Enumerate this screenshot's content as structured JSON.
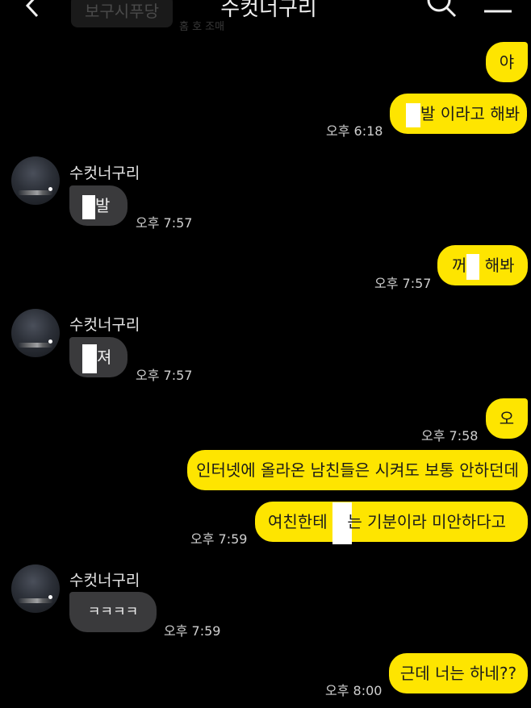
{
  "header": {
    "title": "수컷너구리",
    "chat_badge": "보구시푸당",
    "sub_caption": "홈 호 조매"
  },
  "colors": {
    "background": "#000000",
    "my_bubble": "#fee500",
    "their_bubble": "#3a3a3c"
  },
  "icons": {
    "back": "chevron-left-icon",
    "search": "search-icon",
    "menu": "hamburger-menu-icon"
  },
  "messages": [
    {
      "from": "me",
      "text": "야"
    },
    {
      "from": "me",
      "text_before": "",
      "text_after": "발 이라고 해봐",
      "time": "오후 6:18",
      "censored": true
    },
    {
      "from": "them",
      "sender": "수컷너구리",
      "text_before": "",
      "text_after": "발",
      "time": "오후 7:57",
      "censored": true
    },
    {
      "from": "me",
      "text_before": "꺼",
      "text_after": " 해봐",
      "time": "오후 7:57",
      "censored": true
    },
    {
      "from": "them",
      "sender": "수컷너구리",
      "text_before": "",
      "text_after": "져",
      "time": "오후 7:57",
      "censored": true
    },
    {
      "from": "me",
      "text": "오",
      "time": "오후 7:58"
    },
    {
      "from": "me",
      "text": "인터넷에 올라온 남친들은 시켜도 보통 안하던데"
    },
    {
      "from": "me",
      "text_before": "여친한테 욕",
      "text_after": "는 기분이라 미안하다고",
      "time": "오후 7:59",
      "censored": true
    },
    {
      "from": "them",
      "sender": "수컷너구리",
      "text": "ㅋㅋㅋㅋ",
      "time": "오후 7:59"
    },
    {
      "from": "me",
      "text": "근데 너는 하네??",
      "time": "오후 8:00"
    }
  ]
}
